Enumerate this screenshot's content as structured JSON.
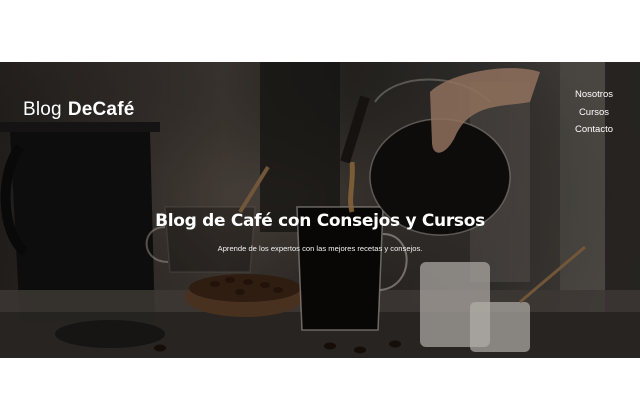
{
  "header": {
    "logo_light": "Blog",
    "logo_bold": "DeCafé"
  },
  "nav": {
    "items": [
      "Nosotros",
      "Cursos",
      "Contacto"
    ]
  },
  "hero": {
    "title": "Blog de Café con Consejos y Cursos",
    "subtitle": "Aprende de los expertos con las mejores recetas y consejos."
  }
}
